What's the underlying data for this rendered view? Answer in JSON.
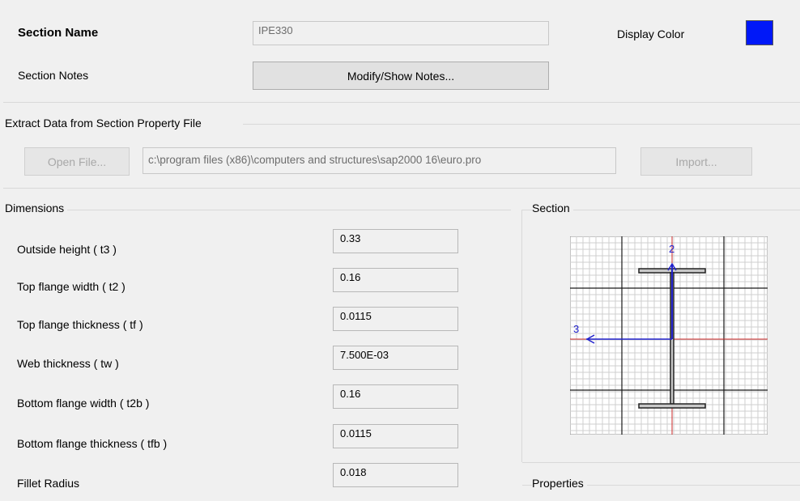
{
  "header": {
    "section_name_label": "Section Name",
    "section_name_value": "IPE330",
    "display_color_label": "Display Color",
    "display_color": "#0018f8",
    "section_notes_label": "Section Notes",
    "notes_button_label": "Modify/Show Notes..."
  },
  "extract": {
    "title": "Extract Data from Section Property File",
    "open_file_label": "Open File...",
    "file_path": "c:\\program files (x86)\\computers and structures\\sap2000 16\\euro.pro",
    "import_label": "Import..."
  },
  "dimensions": {
    "title": "Dimensions",
    "rows": [
      {
        "label": "Outside height  ( t3 )",
        "value": "0.33"
      },
      {
        "label": "Top flange width  ( t2 )",
        "value": "0.16"
      },
      {
        "label": "Top flange thickness  ( tf )",
        "value": "0.0115"
      },
      {
        "label": "Web thickness  ( tw )",
        "value": "7.500E-03"
      },
      {
        "label": "Bottom flange width  ( t2b )",
        "value": "0.16"
      },
      {
        "label": "Bottom flange thickness  ( tfb )",
        "value": "0.0115"
      },
      {
        "label": "Fillet Radius",
        "value": "0.018"
      }
    ]
  },
  "section_panel": {
    "title": "Section",
    "axis_2_label": "2",
    "axis_3_label": "3"
  },
  "properties_panel": {
    "title": "Properties"
  }
}
